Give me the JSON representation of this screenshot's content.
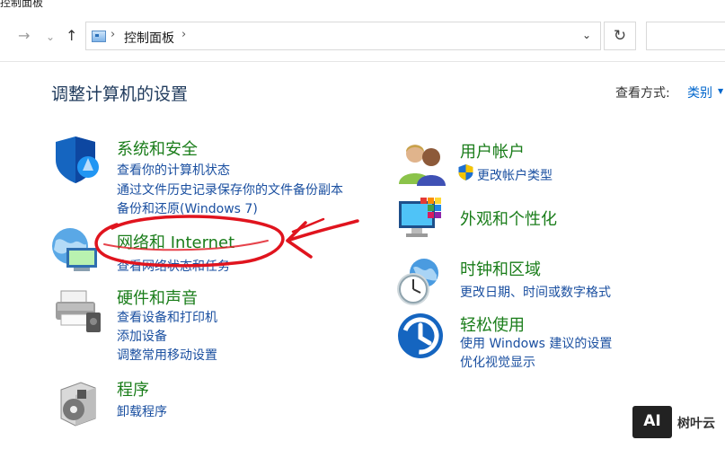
{
  "window": {
    "title": "控制面板"
  },
  "nav": {
    "back": "→",
    "dropdown": "⌄",
    "up": "↑",
    "breadcrumb": "控制面板",
    "crumb_sep": "›",
    "address_dropdown": "⌄",
    "refresh": "↻"
  },
  "header": {
    "title": "调整计算机的设置",
    "view_label": "查看方式:",
    "view_value": "类别",
    "view_caret": "▼"
  },
  "categories": {
    "security": {
      "heading": "系统和安全",
      "links": [
        "查看你的计算机状态",
        "通过文件历史记录保存你的文件备份副本",
        "备份和还原(Windows 7)"
      ],
      "icon": "shield-icon"
    },
    "network": {
      "heading": "网络和 Internet",
      "links": [
        "查看网络状态和任务"
      ],
      "icon": "network-globe-icon"
    },
    "hardware": {
      "heading": "硬件和声音",
      "links": [
        "查看设备和打印机",
        "添加设备",
        "调整常用移动设置"
      ],
      "icon": "printer-icon"
    },
    "programs": {
      "heading": "程序",
      "links": [
        "卸载程序"
      ],
      "icon": "programs-box-icon"
    },
    "users": {
      "heading": "用户帐户",
      "links": [
        "更改帐户类型"
      ],
      "icon": "users-icon"
    },
    "appearance": {
      "heading": "外观和个性化",
      "links": [],
      "icon": "monitor-palette-icon"
    },
    "clock": {
      "heading": "时钟和区域",
      "links": [
        "更改日期、时间或数字格式"
      ],
      "icon": "clock-globe-icon"
    },
    "ease": {
      "heading": "轻松使用",
      "links": [
        "使用 Windows 建议的设置",
        "优化视觉显示"
      ],
      "icon": "ease-of-access-icon"
    }
  },
  "watermark": {
    "logo": "AI",
    "text": "树叶云"
  },
  "colors": {
    "heading_green": "#1a7d1a",
    "link_blue": "#1a4fa0",
    "title_navy": "#1e395b",
    "annotation_red": "#e0141e"
  }
}
